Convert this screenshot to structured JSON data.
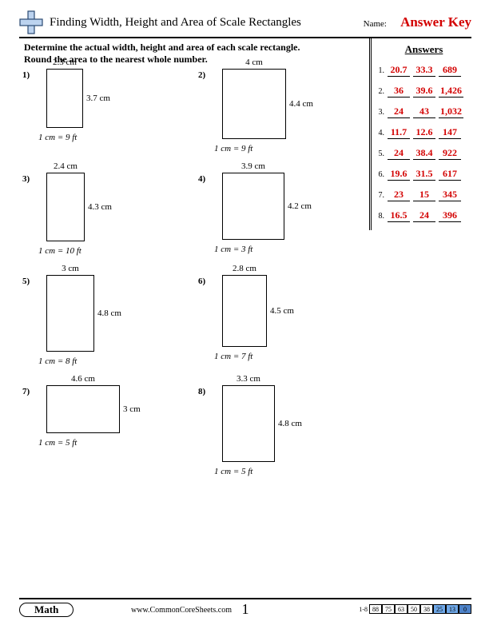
{
  "header": {
    "title": "Finding Width, Height and Area of Scale Rectangles",
    "name_label": "Name:",
    "answer_key": "Answer Key"
  },
  "instructions_line1": "Determine the actual width, height and area of each scale rectangle.",
  "instructions_line2": "Round the area to the nearest whole number.",
  "answers_title": "Answers",
  "answers": [
    {
      "n": "1.",
      "w": "20.7",
      "h": "33.3",
      "a": "689"
    },
    {
      "n": "2.",
      "w": "36",
      "h": "39.6",
      "a": "1,426"
    },
    {
      "n": "3.",
      "w": "24",
      "h": "43",
      "a": "1,032"
    },
    {
      "n": "4.",
      "w": "11.7",
      "h": "12.6",
      "a": "147"
    },
    {
      "n": "5.",
      "w": "24",
      "h": "38.4",
      "a": "922"
    },
    {
      "n": "6.",
      "w": "19.6",
      "h": "31.5",
      "a": "617"
    },
    {
      "n": "7.",
      "w": "23",
      "h": "15",
      "a": "345"
    },
    {
      "n": "8.",
      "w": "16.5",
      "h": "24",
      "a": "396"
    }
  ],
  "problems": [
    {
      "n": "1)",
      "w_label": "2.3 cm",
      "h_label": "3.7 cm",
      "scale": "1 cm = 9 ft",
      "pxw": 46,
      "pxh": 74
    },
    {
      "n": "2)",
      "w_label": "4 cm",
      "h_label": "4.4 cm",
      "scale": "1 cm = 9 ft",
      "pxw": 80,
      "pxh": 88
    },
    {
      "n": "3)",
      "w_label": "2.4 cm",
      "h_label": "4.3 cm",
      "scale": "1 cm = 10 ft",
      "pxw": 48,
      "pxh": 86
    },
    {
      "n": "4)",
      "w_label": "3.9 cm",
      "h_label": "4.2 cm",
      "scale": "1 cm = 3 ft",
      "pxw": 78,
      "pxh": 84
    },
    {
      "n": "5)",
      "w_label": "3 cm",
      "h_label": "4.8 cm",
      "scale": "1 cm = 8 ft",
      "pxw": 60,
      "pxh": 96
    },
    {
      "n": "6)",
      "w_label": "2.8 cm",
      "h_label": "4.5 cm",
      "scale": "1 cm = 7 ft",
      "pxw": 56,
      "pxh": 90
    },
    {
      "n": "7)",
      "w_label": "4.6 cm",
      "h_label": "3 cm",
      "scale": "1 cm = 5 ft",
      "pxw": 92,
      "pxh": 60
    },
    {
      "n": "8)",
      "w_label": "3.3 cm",
      "h_label": "4.8 cm",
      "scale": "1 cm = 5 ft",
      "pxw": 66,
      "pxh": 96
    }
  ],
  "footer": {
    "subject": "Math",
    "site": "www.CommonCoreSheets.com",
    "page": "1",
    "range": "1-8",
    "scores": [
      "88",
      "75",
      "63",
      "50",
      "38",
      "25",
      "13",
      "0"
    ]
  }
}
